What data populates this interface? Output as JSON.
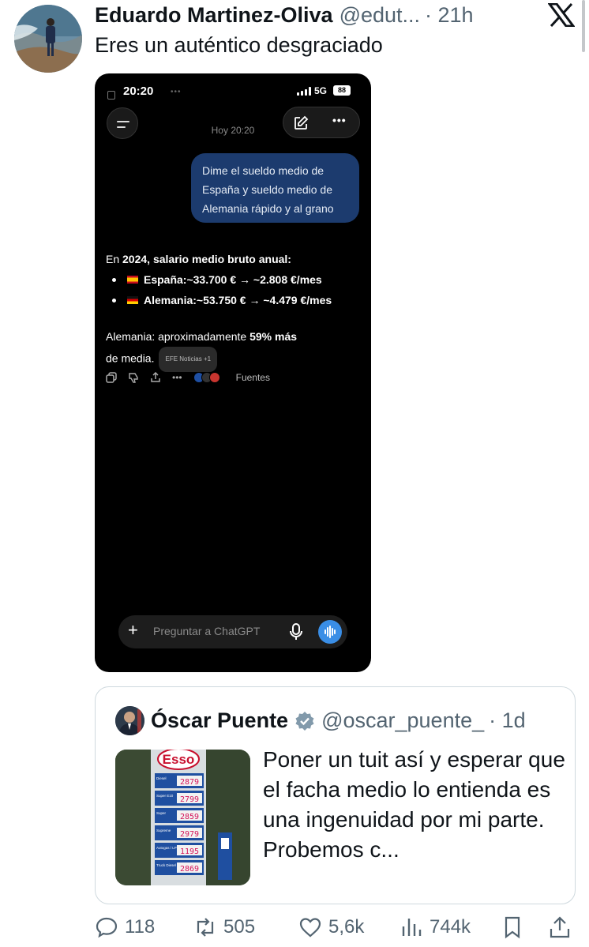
{
  "tweet": {
    "author_name": "Eduardo Martinez-Oliva",
    "author_handle": "@edut...",
    "time": "· 21h",
    "text": "Eres un auténtico desgraciado"
  },
  "phone": {
    "status_time": "20:20",
    "network": "5G",
    "battery": "88",
    "date_label": "Hoy 20:20",
    "user_message": "Dime el sueldo medio de España y sueldo medio de Alemania rápido y al grano",
    "answer": {
      "intro_prefix": "En ",
      "intro_bold": "2024, salario medio bruto anual:",
      "bullets": [
        {
          "country": "España:",
          "value": " ~33.700 € → ~2.808 €/mes",
          "flag": "es"
        },
        {
          "country": "Alemania:",
          "value": " ~53.750 € → ~4.479 €/mes",
          "flag": "de"
        }
      ],
      "conclusion_prefix": "Alemania: aproximadamente ",
      "conclusion_bold": "59% más",
      "conclusion_line2": "de media.",
      "citation": "EFE Noticias +1"
    },
    "actions": {
      "sources_label": "Fuentes"
    },
    "input_placeholder": "Preguntar a ChatGPT"
  },
  "quoted_tweet": {
    "author_name": "Óscar Puente",
    "author_handle": "@oscar_puente_",
    "time": "· 1d",
    "text": "Poner un tuit así y esperar que el facha medio lo entienda es una ingenuidad por mi parte. Probemos c...",
    "image_brand": "Esso",
    "fuel_prices": [
      {
        "label": "Diesel",
        "price": "2879"
      },
      {
        "label": "Super E10",
        "price": "2799"
      },
      {
        "label": "Super",
        "price": "2859"
      },
      {
        "label": "Supreme",
        "price": "2979"
      },
      {
        "label": "Autogas / LPG",
        "price": "1195"
      },
      {
        "label": "Truck Diesel",
        "price": "2869"
      }
    ]
  },
  "stats": {
    "replies": "118",
    "reposts": "505",
    "likes": "5,6k",
    "views": "744k"
  },
  "colors": {
    "text_primary": "#0f1419",
    "text_secondary": "#536471",
    "border": "#cfd9de",
    "bubble": "#1c3b6e",
    "verified_gray": "#829aab",
    "voice_blue": "#3a8ee6"
  }
}
